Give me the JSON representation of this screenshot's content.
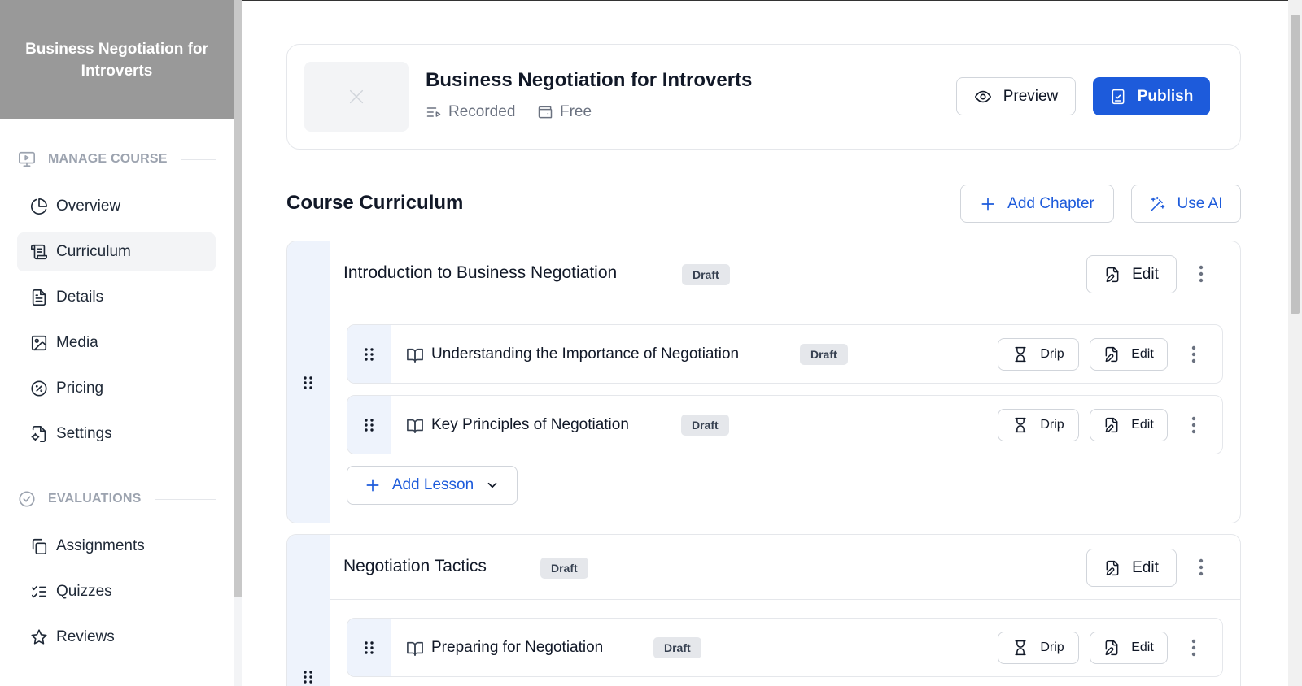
{
  "sidebar": {
    "course_title": "Business Negotiation for Introverts",
    "manage_label": "MANAGE COURSE",
    "manage_items": [
      {
        "label": "Overview",
        "icon": "pie-chart-icon"
      },
      {
        "label": "Curriculum",
        "icon": "scroll-icon",
        "active": true
      },
      {
        "label": "Details",
        "icon": "file-text-icon"
      },
      {
        "label": "Media",
        "icon": "image-icon"
      },
      {
        "label": "Pricing",
        "icon": "badge-percent-icon"
      },
      {
        "label": "Settings",
        "icon": "file-cog-icon"
      }
    ],
    "evaluations_label": "EVALUATIONS",
    "evaluation_items": [
      {
        "label": "Assignments",
        "icon": "copy-icon"
      },
      {
        "label": "Quizzes",
        "icon": "list-checks-icon"
      },
      {
        "label": "Reviews",
        "icon": "star-icon"
      }
    ]
  },
  "course": {
    "title": "Business Negotiation for Introverts",
    "type": "Recorded",
    "price": "Free",
    "preview_label": "Preview",
    "publish_label": "Publish"
  },
  "curriculum": {
    "title": "Course Curriculum",
    "add_chapter_label": "Add Chapter",
    "use_ai_label": "Use AI",
    "chapters": [
      {
        "title": "Introduction to Business Negotiation",
        "status": "Draft",
        "edit_label": "Edit",
        "lessons": [
          {
            "title": "Understanding the Importance of Negotiation",
            "status": "Draft",
            "drip_label": "Drip",
            "edit_label": "Edit"
          },
          {
            "title": "Key Principles of Negotiation",
            "status": "Draft",
            "drip_label": "Drip",
            "edit_label": "Edit"
          }
        ],
        "add_lesson_label": "Add Lesson"
      },
      {
        "title": "Negotiation Tactics",
        "status": "Draft",
        "edit_label": "Edit",
        "lessons": [
          {
            "title": "Preparing for Negotiation",
            "status": "Draft",
            "drip_label": "Drip",
            "edit_label": "Edit"
          }
        ]
      }
    ]
  },
  "colors": {
    "primary": "#1d5bdb",
    "sidebar_header": "#999999",
    "rail": "#eef3fc"
  }
}
